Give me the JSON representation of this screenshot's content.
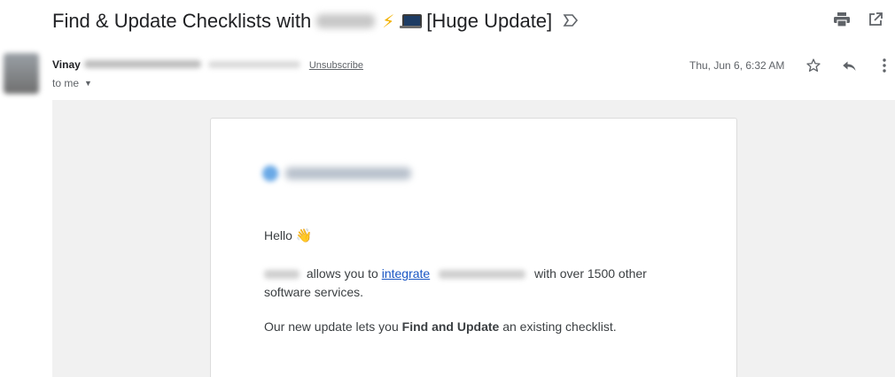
{
  "subject": {
    "title_prefix": "Find & Update Checklists with",
    "title_suffix": "[Huge Update]",
    "lightning_emoji": "⚡"
  },
  "toolbar": {
    "print_icon": "print-icon",
    "open_new_window_icon": "open-in-new-window-icon"
  },
  "message": {
    "sender_name": "Vinay",
    "unsubscribe_label": "Unsubscribe",
    "to_label": "to me",
    "date": "Thu, Jun 6, 6:32 AM",
    "star_icon": "star-icon",
    "reply_icon": "reply-icon",
    "more_icon": "more-vert-icon"
  },
  "body": {
    "greeting": "Hello",
    "wave_emoji": "👋",
    "para1_part1": "allows you to",
    "para1_link": "integrate",
    "para1_part2": "with over 1500 other software services.",
    "para2_part1": "Our new update lets you",
    "para2_bold": "Find and Update",
    "para2_part2": "an existing checklist."
  }
}
